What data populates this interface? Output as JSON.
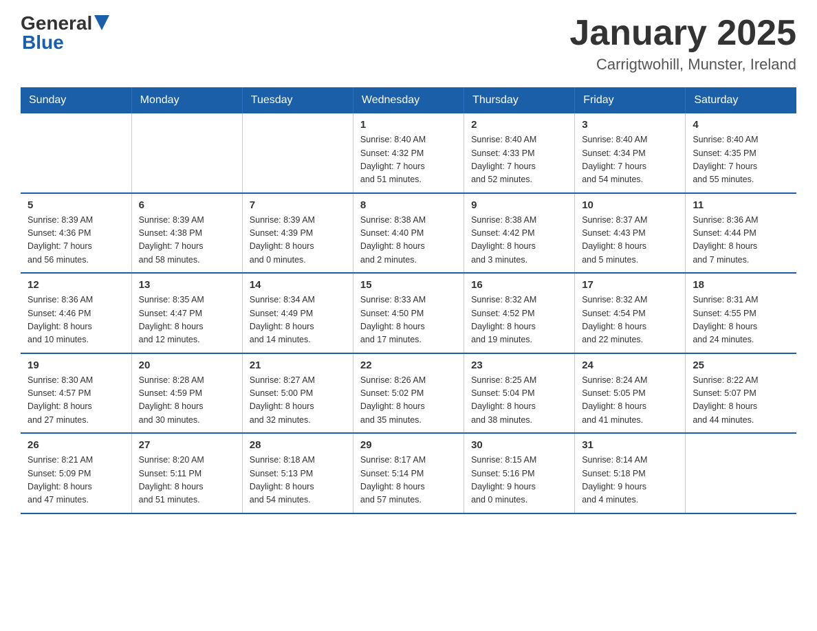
{
  "header": {
    "logo_general": "General",
    "logo_blue": "Blue",
    "month_title": "January 2025",
    "location": "Carrigtwohill, Munster, Ireland"
  },
  "weekdays": [
    "Sunday",
    "Monday",
    "Tuesday",
    "Wednesday",
    "Thursday",
    "Friday",
    "Saturday"
  ],
  "weeks": [
    [
      {
        "day": "",
        "info": ""
      },
      {
        "day": "",
        "info": ""
      },
      {
        "day": "",
        "info": ""
      },
      {
        "day": "1",
        "info": "Sunrise: 8:40 AM\nSunset: 4:32 PM\nDaylight: 7 hours\nand 51 minutes."
      },
      {
        "day": "2",
        "info": "Sunrise: 8:40 AM\nSunset: 4:33 PM\nDaylight: 7 hours\nand 52 minutes."
      },
      {
        "day": "3",
        "info": "Sunrise: 8:40 AM\nSunset: 4:34 PM\nDaylight: 7 hours\nand 54 minutes."
      },
      {
        "day": "4",
        "info": "Sunrise: 8:40 AM\nSunset: 4:35 PM\nDaylight: 7 hours\nand 55 minutes."
      }
    ],
    [
      {
        "day": "5",
        "info": "Sunrise: 8:39 AM\nSunset: 4:36 PM\nDaylight: 7 hours\nand 56 minutes."
      },
      {
        "day": "6",
        "info": "Sunrise: 8:39 AM\nSunset: 4:38 PM\nDaylight: 7 hours\nand 58 minutes."
      },
      {
        "day": "7",
        "info": "Sunrise: 8:39 AM\nSunset: 4:39 PM\nDaylight: 8 hours\nand 0 minutes."
      },
      {
        "day": "8",
        "info": "Sunrise: 8:38 AM\nSunset: 4:40 PM\nDaylight: 8 hours\nand 2 minutes."
      },
      {
        "day": "9",
        "info": "Sunrise: 8:38 AM\nSunset: 4:42 PM\nDaylight: 8 hours\nand 3 minutes."
      },
      {
        "day": "10",
        "info": "Sunrise: 8:37 AM\nSunset: 4:43 PM\nDaylight: 8 hours\nand 5 minutes."
      },
      {
        "day": "11",
        "info": "Sunrise: 8:36 AM\nSunset: 4:44 PM\nDaylight: 8 hours\nand 7 minutes."
      }
    ],
    [
      {
        "day": "12",
        "info": "Sunrise: 8:36 AM\nSunset: 4:46 PM\nDaylight: 8 hours\nand 10 minutes."
      },
      {
        "day": "13",
        "info": "Sunrise: 8:35 AM\nSunset: 4:47 PM\nDaylight: 8 hours\nand 12 minutes."
      },
      {
        "day": "14",
        "info": "Sunrise: 8:34 AM\nSunset: 4:49 PM\nDaylight: 8 hours\nand 14 minutes."
      },
      {
        "day": "15",
        "info": "Sunrise: 8:33 AM\nSunset: 4:50 PM\nDaylight: 8 hours\nand 17 minutes."
      },
      {
        "day": "16",
        "info": "Sunrise: 8:32 AM\nSunset: 4:52 PM\nDaylight: 8 hours\nand 19 minutes."
      },
      {
        "day": "17",
        "info": "Sunrise: 8:32 AM\nSunset: 4:54 PM\nDaylight: 8 hours\nand 22 minutes."
      },
      {
        "day": "18",
        "info": "Sunrise: 8:31 AM\nSunset: 4:55 PM\nDaylight: 8 hours\nand 24 minutes."
      }
    ],
    [
      {
        "day": "19",
        "info": "Sunrise: 8:30 AM\nSunset: 4:57 PM\nDaylight: 8 hours\nand 27 minutes."
      },
      {
        "day": "20",
        "info": "Sunrise: 8:28 AM\nSunset: 4:59 PM\nDaylight: 8 hours\nand 30 minutes."
      },
      {
        "day": "21",
        "info": "Sunrise: 8:27 AM\nSunset: 5:00 PM\nDaylight: 8 hours\nand 32 minutes."
      },
      {
        "day": "22",
        "info": "Sunrise: 8:26 AM\nSunset: 5:02 PM\nDaylight: 8 hours\nand 35 minutes."
      },
      {
        "day": "23",
        "info": "Sunrise: 8:25 AM\nSunset: 5:04 PM\nDaylight: 8 hours\nand 38 minutes."
      },
      {
        "day": "24",
        "info": "Sunrise: 8:24 AM\nSunset: 5:05 PM\nDaylight: 8 hours\nand 41 minutes."
      },
      {
        "day": "25",
        "info": "Sunrise: 8:22 AM\nSunset: 5:07 PM\nDaylight: 8 hours\nand 44 minutes."
      }
    ],
    [
      {
        "day": "26",
        "info": "Sunrise: 8:21 AM\nSunset: 5:09 PM\nDaylight: 8 hours\nand 47 minutes."
      },
      {
        "day": "27",
        "info": "Sunrise: 8:20 AM\nSunset: 5:11 PM\nDaylight: 8 hours\nand 51 minutes."
      },
      {
        "day": "28",
        "info": "Sunrise: 8:18 AM\nSunset: 5:13 PM\nDaylight: 8 hours\nand 54 minutes."
      },
      {
        "day": "29",
        "info": "Sunrise: 8:17 AM\nSunset: 5:14 PM\nDaylight: 8 hours\nand 57 minutes."
      },
      {
        "day": "30",
        "info": "Sunrise: 8:15 AM\nSunset: 5:16 PM\nDaylight: 9 hours\nand 0 minutes."
      },
      {
        "day": "31",
        "info": "Sunrise: 8:14 AM\nSunset: 5:18 PM\nDaylight: 9 hours\nand 4 minutes."
      },
      {
        "day": "",
        "info": ""
      }
    ]
  ]
}
